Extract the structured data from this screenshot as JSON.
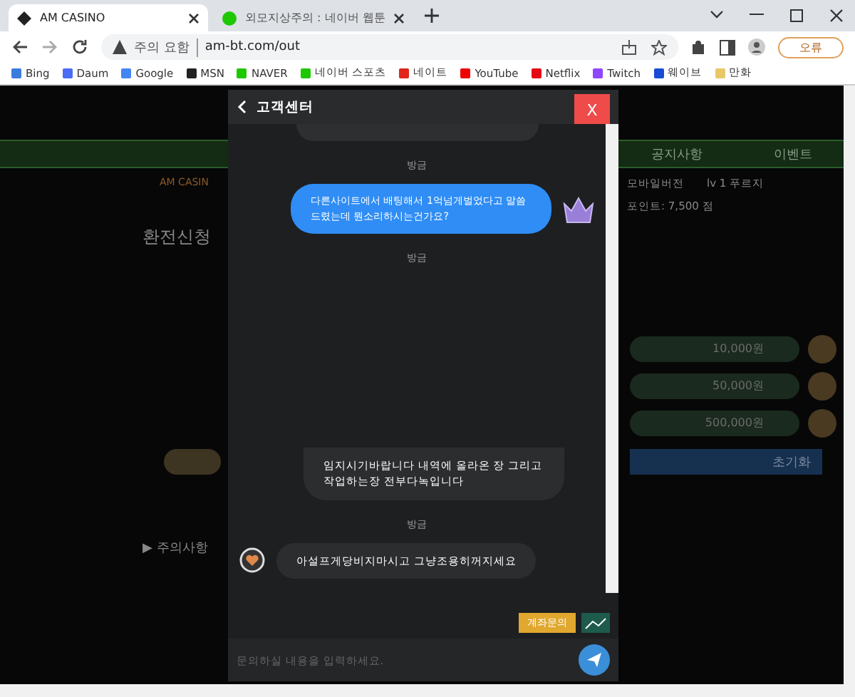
{
  "browser": {
    "tabs": [
      {
        "title": "AM CASINO",
        "selected": true
      },
      {
        "title": "외모지상주의 : 네이버 웹툰",
        "selected": false
      }
    ],
    "address": {
      "warning": "주의 요함",
      "url": "am-bt.com/out"
    },
    "profile_button": "오류",
    "bookmarks": [
      "Bing",
      "Daum",
      "Google",
      "MSN",
      "NAVER",
      "네이버 스포츠",
      "네이트",
      "YouTube",
      "Netflix",
      "Twitch",
      "웨이브",
      "만화"
    ]
  },
  "page": {
    "nav": [
      {
        "label": "공지사항"
      },
      {
        "label": "이벤트"
      }
    ],
    "brand": "AM CASIN",
    "mobile": "모바일버전",
    "level": "lv 1 푸르지",
    "points": "포인트: 7,500 점",
    "heading": "환전신청",
    "amounts": [
      "10,000원",
      "50,000원",
      "500,000원"
    ],
    "reset": "초기화",
    "notice": "▶ 주의사항"
  },
  "chat": {
    "title": "고객센터",
    "close": "X",
    "messages": [
      {
        "kind": "time",
        "text": "방금"
      },
      {
        "kind": "user",
        "text": "다른사이트에서 배팅해서 1억넘게벌었다고 말씀드렸는데 뭔소리하시는건가요?"
      },
      {
        "kind": "time",
        "text": "방금"
      },
      {
        "kind": "gap"
      },
      {
        "kind": "admin_cont",
        "text": "임지시기바랍니다 내역에 올라온 장 그리고 작업하는장 전부다녹입니다"
      },
      {
        "kind": "time",
        "text": "방금"
      },
      {
        "kind": "admin",
        "text": "아설프게당비지마시고 그냥조용히꺼지세요"
      }
    ],
    "account_button": "계좌문의",
    "placeholder": "문의하실 내용을 입력하세요."
  }
}
